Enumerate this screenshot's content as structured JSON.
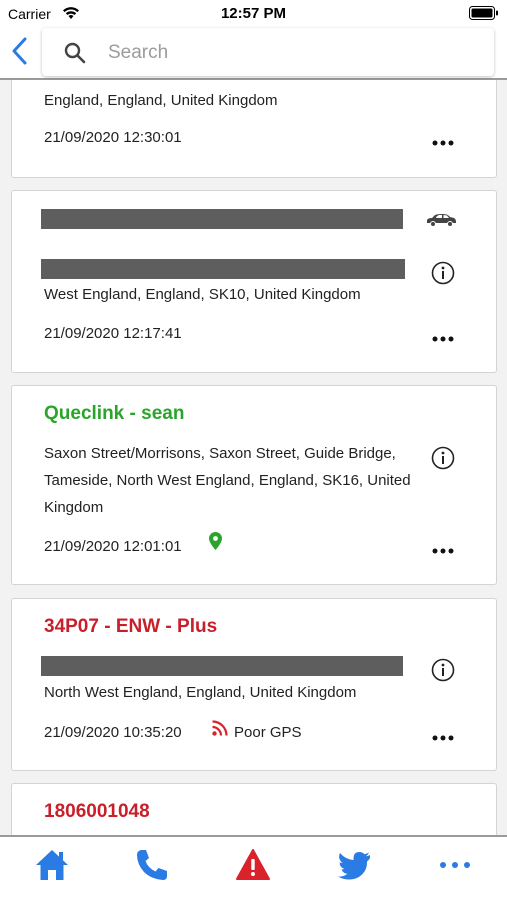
{
  "status_bar": {
    "carrier": "Carrier",
    "time": "12:57 PM"
  },
  "search": {
    "placeholder": "Search",
    "value": ""
  },
  "cards": [
    {
      "address": "England, England, United Kingdom",
      "timestamp": "21/09/2020 12:30:01"
    },
    {
      "address": "West England, England, SK10, United Kingdom",
      "timestamp": "21/09/2020 12:17:41"
    },
    {
      "title": "Queclink - sean",
      "title_color": "#2aa52a",
      "address": "Saxon Street/Morrisons, Saxon Street, Guide Bridge, Tameside, North West England, England, SK16, United Kingdom",
      "timestamp": "21/09/2020 12:01:01"
    },
    {
      "title": "34P07 - ENW - Plus",
      "title_color": "#c8202a",
      "address": "North West England, England, United Kingdom",
      "timestamp": "21/09/2020 10:35:20",
      "gps_status": "Poor GPS"
    },
    {
      "title": "1806001048",
      "title_color": "#c8202a"
    }
  ],
  "tabs": [
    {
      "icon": "home-icon"
    },
    {
      "icon": "phone-icon"
    },
    {
      "icon": "alert-icon"
    },
    {
      "icon": "twitter-icon"
    },
    {
      "icon": "more-icon"
    }
  ],
  "colors": {
    "accent_blue": "#2a7be4",
    "alert_red": "#d9222a",
    "green": "#2aa52a"
  }
}
